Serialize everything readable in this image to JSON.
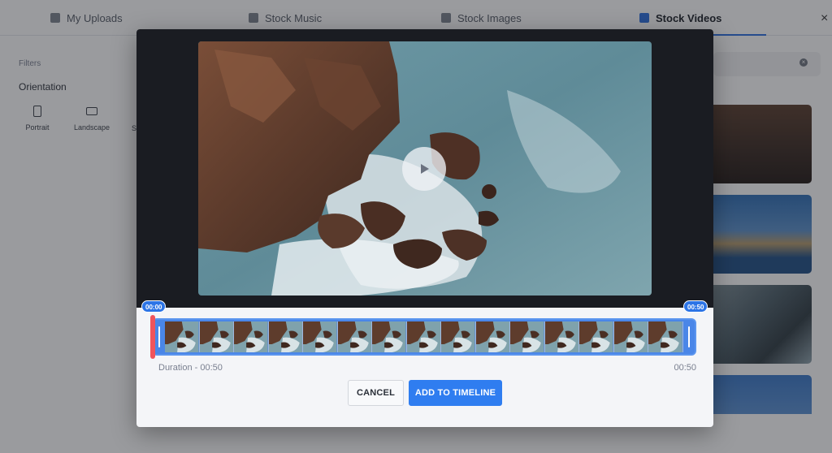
{
  "tabs": [
    {
      "label": "My Uploads",
      "icon": "upload-folder-icon"
    },
    {
      "label": "Stock Music",
      "icon": "music-note-icon"
    },
    {
      "label": "Stock Images",
      "icon": "image-icon"
    },
    {
      "label": "Stock Videos",
      "icon": "video-icon",
      "active": true
    }
  ],
  "close_label": "×",
  "filters": {
    "title": "Filters",
    "orientation_title": "Orientation",
    "options": [
      "Portrait",
      "Landscape",
      "S"
    ]
  },
  "clear_glyph": "×",
  "modal": {
    "playhead_start": "00:00",
    "playhead_end": "00:50",
    "duration_label": "Duration - 00:50",
    "end_time": "00:50",
    "cancel_label": "CANCEL",
    "add_label": "ADD TO TIMELINE",
    "accent_color": "#2f7df0",
    "playhead_color": "#f0545c",
    "frame_count": 15
  }
}
